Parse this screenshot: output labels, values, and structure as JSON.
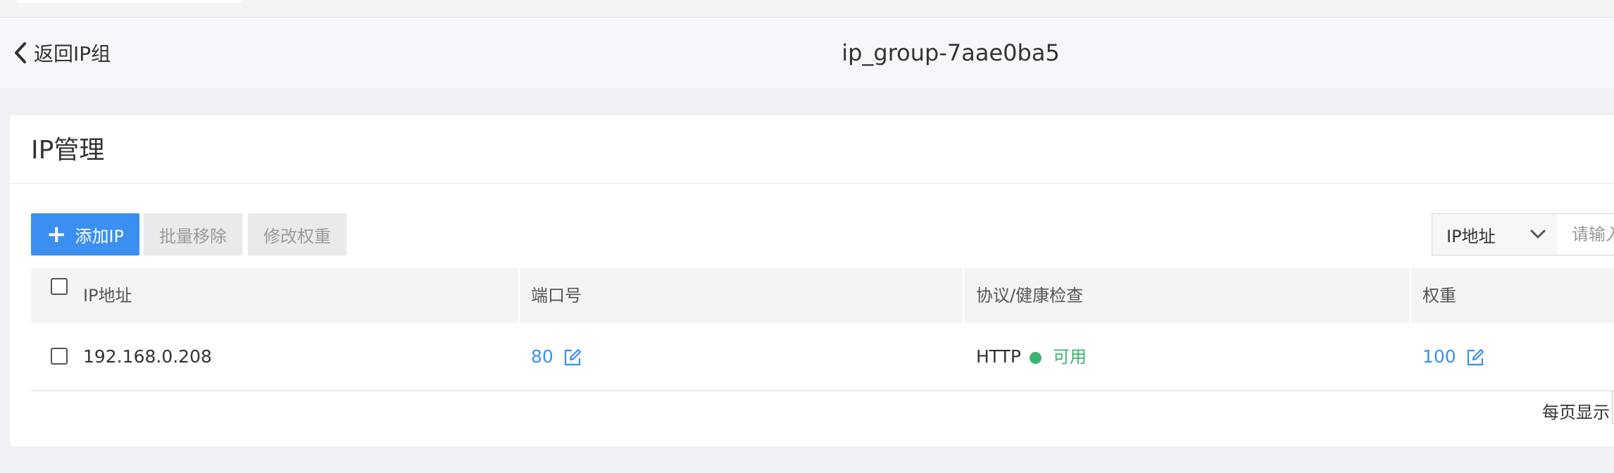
{
  "header": {
    "back_label": "返回IP组",
    "title": "ip_group-7aae0ba5"
  },
  "card": {
    "title": "IP管理",
    "toolbar": {
      "add_label": "添加IP",
      "batch_remove_label": "批量移除",
      "edit_weight_label": "修改权重"
    },
    "search": {
      "field_selected": "IP地址",
      "placeholder": "请输入"
    },
    "table": {
      "columns": [
        "IP地址",
        "端口号",
        "协议/健康检查",
        "权重"
      ],
      "rows": [
        {
          "ip": "192.168.0.208",
          "port": "80",
          "protocol": "HTTP",
          "health": "可用",
          "weight": "100"
        }
      ]
    },
    "pagination": {
      "page_size_label": "每页显示"
    }
  },
  "colors": {
    "accent": "#3b8ff0",
    "healthy": "#3cb371",
    "disabled_bg": "#e9eaec"
  },
  "icons": [
    "chevron-left-icon",
    "plus-icon",
    "chevron-down-icon",
    "edit-icon",
    "status-dot-icon"
  ]
}
